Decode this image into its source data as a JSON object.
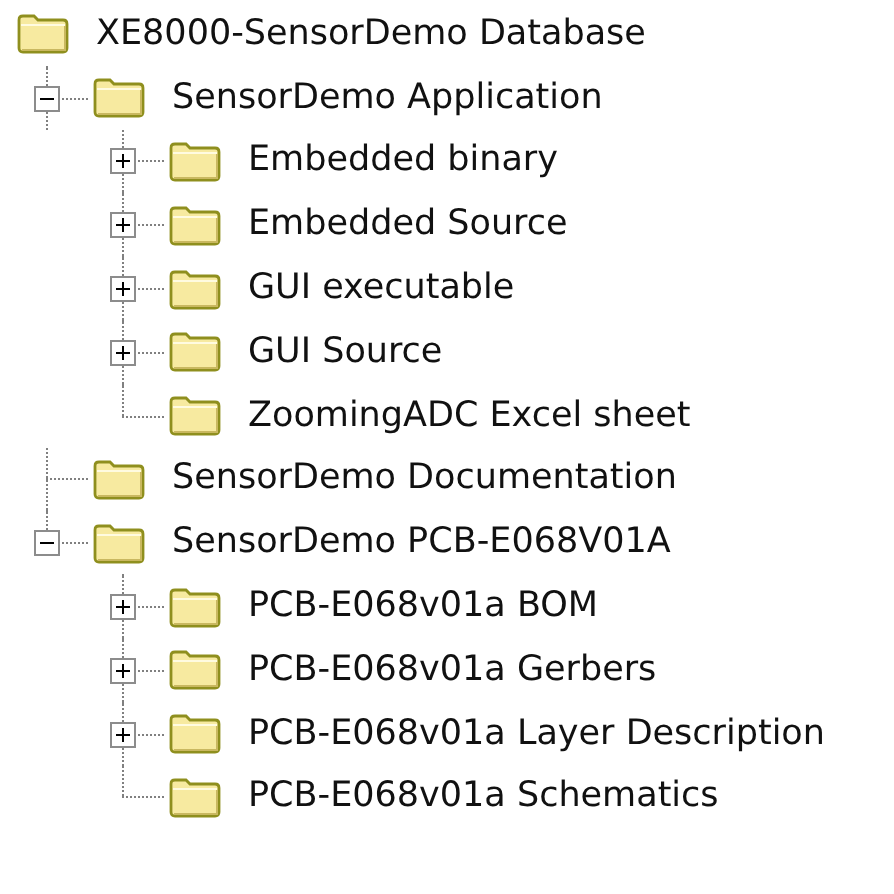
{
  "tree": [
    {
      "label": "XE8000-SensorDemo Database",
      "children": [
        {
          "label": "SensorDemo Application",
          "expanded": true,
          "children": [
            {
              "label": "Embedded binary",
              "expanded": false
            },
            {
              "label": "Embedded Source",
              "expanded": false
            },
            {
              "label": "GUI executable",
              "expanded": false
            },
            {
              "label": "GUI Source",
              "expanded": false
            },
            {
              "label": "ZoomingADC Excel sheet"
            }
          ]
        },
        {
          "label": "SensorDemo Documentation"
        },
        {
          "label": "SensorDemo PCB-E068V01A",
          "expanded": true,
          "children": [
            {
              "label": "PCB-E068v01a BOM",
              "expanded": false
            },
            {
              "label": "PCB-E068v01a Gerbers",
              "expanded": false
            },
            {
              "label": "PCB-E068v01a Layer Description",
              "expanded": false
            },
            {
              "label": "PCB-E068v01a Schematics"
            }
          ]
        }
      ]
    }
  ]
}
